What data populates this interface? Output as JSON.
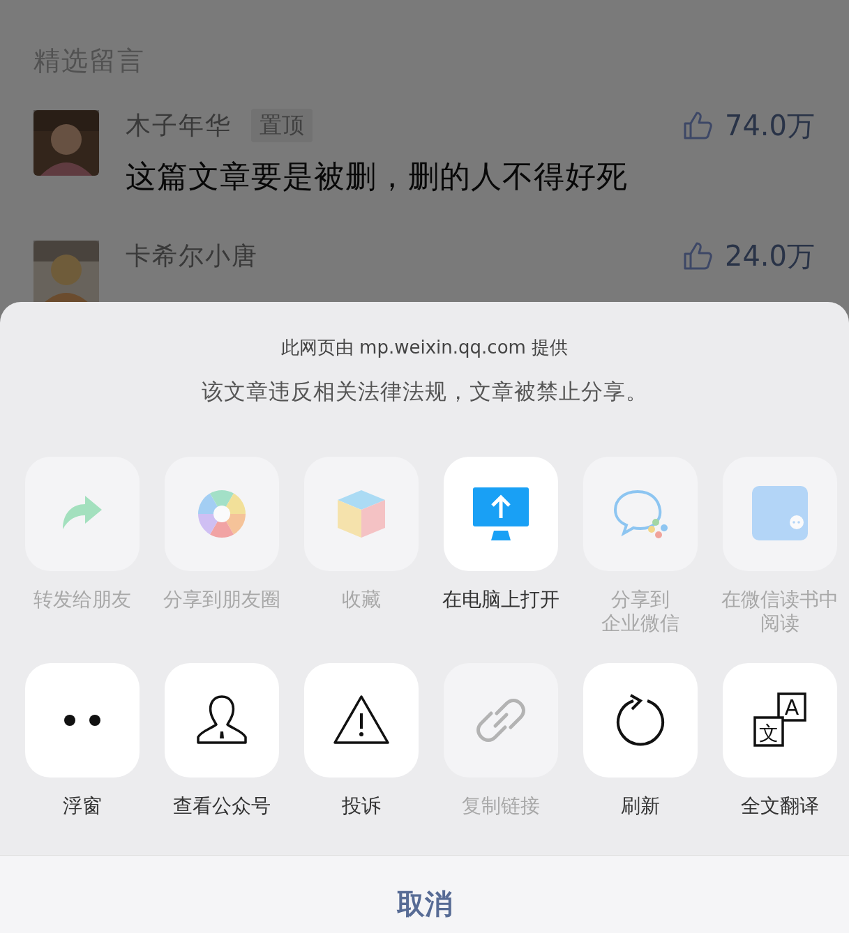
{
  "comments_section": {
    "title": "精选留言",
    "comments": [
      {
        "name": "木子年华",
        "badge": "置顶",
        "likes": "74.0万",
        "text": "这篇文章要是被删，删的人不得好死"
      },
      {
        "name": "卡希尔小唐",
        "likes": "24.0万"
      }
    ]
  },
  "share_sheet": {
    "provider_note": "此网页由 mp.weixin.qq.com 提供",
    "notice": "该文章违反相关法律法规，文章被禁止分享。",
    "action_rows": [
      {
        "items": [
          {
            "kind": "forward",
            "label": "转发给朋友",
            "disabled": true
          },
          {
            "kind": "moments",
            "label": "分享到朋友圈",
            "disabled": true
          },
          {
            "kind": "favorite",
            "label": "收藏",
            "disabled": true
          },
          {
            "kind": "computer",
            "label": "在电脑上打开",
            "disabled": false
          },
          {
            "kind": "wecom",
            "label_lines": [
              "分享到",
              "企业微信"
            ],
            "disabled": true
          },
          {
            "kind": "weread",
            "label_lines": [
              "在微信读书中",
              "阅读"
            ],
            "disabled": true
          }
        ]
      },
      {
        "items": [
          {
            "kind": "float",
            "label": "浮窗",
            "disabled": false
          },
          {
            "kind": "account",
            "label": "查看公众号",
            "disabled": false
          },
          {
            "kind": "report",
            "label": "投诉",
            "disabled": false
          },
          {
            "kind": "link",
            "label": "复制链接",
            "disabled": true
          },
          {
            "kind": "refresh",
            "label": "刷新",
            "disabled": false
          },
          {
            "kind": "translate",
            "label": "全文翻译",
            "disabled": false,
            "icon_text": [
              "文",
              "A"
            ]
          }
        ]
      }
    ],
    "cancel": "取消"
  }
}
